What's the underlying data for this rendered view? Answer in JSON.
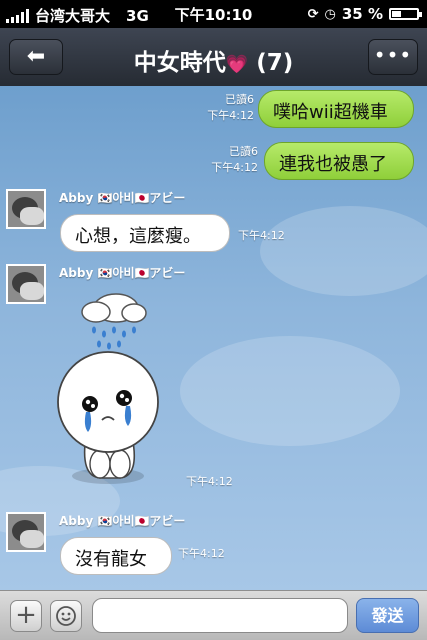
{
  "status_bar": {
    "carrier": "台湾大哥大",
    "network": "3G",
    "time": "下午10:10",
    "battery": "35 %",
    "battery_level": 0.35
  },
  "navbar": {
    "title": "中女時代",
    "heart": "💗",
    "member_count": "(7)",
    "more_label": "•••"
  },
  "messages": [
    {
      "direction": "out",
      "read": "已讀6",
      "time": "下午4:12",
      "text": "噗哈wii超機車"
    },
    {
      "direction": "out",
      "read": "已讀6",
      "time": "下午4:12",
      "text": "連我也被愚了"
    },
    {
      "direction": "in",
      "sender": "Abby 🇰🇷아비🇯🇵アビー",
      "time": "下午4:12",
      "text": "心想，這麼瘦。"
    },
    {
      "direction": "in",
      "sender": "Abby 🇰🇷아비🇯🇵アビー",
      "time": "下午4:12",
      "sticker": "crying-moon-sticker"
    },
    {
      "direction": "in",
      "sender": "Abby 🇰🇷아비🇯🇵アビー",
      "time": "下午4:12",
      "text": "沒有龍女"
    }
  ],
  "input_bar": {
    "placeholder": "",
    "send_label": "發送"
  }
}
